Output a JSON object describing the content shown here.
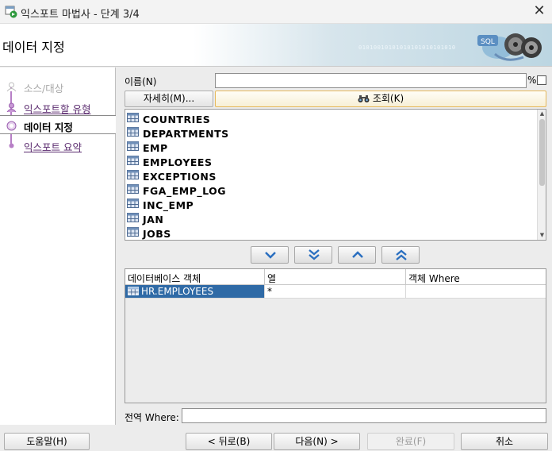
{
  "window": {
    "title": "익스포트 마법사 - 단계 3/4",
    "close_glyph": "✕"
  },
  "header": {
    "heading": "데이터 지정",
    "decor_binary": "01010010101010101010101010"
  },
  "steps": [
    {
      "label": "소스/대상",
      "state": "disabled"
    },
    {
      "label": "익스포트할 유형",
      "state": "link"
    },
    {
      "label": "데이터 지정",
      "state": "current"
    },
    {
      "label": "익스포트 요약",
      "state": "link"
    }
  ],
  "filter": {
    "name_label": "이름(N)",
    "name_value": "",
    "percent_suffix": "%",
    "auto_percent_checked": false,
    "more_button": "자세히(M)...",
    "find_button": "조회(K)",
    "find_icon": "binoculars-icon"
  },
  "objects": {
    "items": [
      "COUNTRIES",
      "DEPARTMENTS",
      "EMP",
      "EMPLOYEES",
      "EXCEPTIONS",
      "FGA_EMP_LOG",
      "INC_EMP",
      "JAN",
      "JOBS"
    ],
    "item_icon": "table-icon"
  },
  "move_buttons": [
    "move-down",
    "move-all-down",
    "move-up",
    "move-all-up"
  ],
  "selected": {
    "columns": [
      "데이터베이스 객체",
      "열",
      "객체 Where"
    ],
    "rows": [
      {
        "object": "HR.EMPLOYEES",
        "columns": "*",
        "where": ""
      }
    ]
  },
  "global_where": {
    "label": "전역 Where:",
    "value": ""
  },
  "footer": {
    "help": "도움말(H)",
    "back": "< 뒤로(B)",
    "next": "다음(N) >",
    "finish": "완료(F)",
    "cancel": "취소"
  },
  "colors": {
    "accent_purple": "#b77fc6",
    "selection_blue": "#2f6aa6",
    "find_border": "#e6b85a"
  }
}
